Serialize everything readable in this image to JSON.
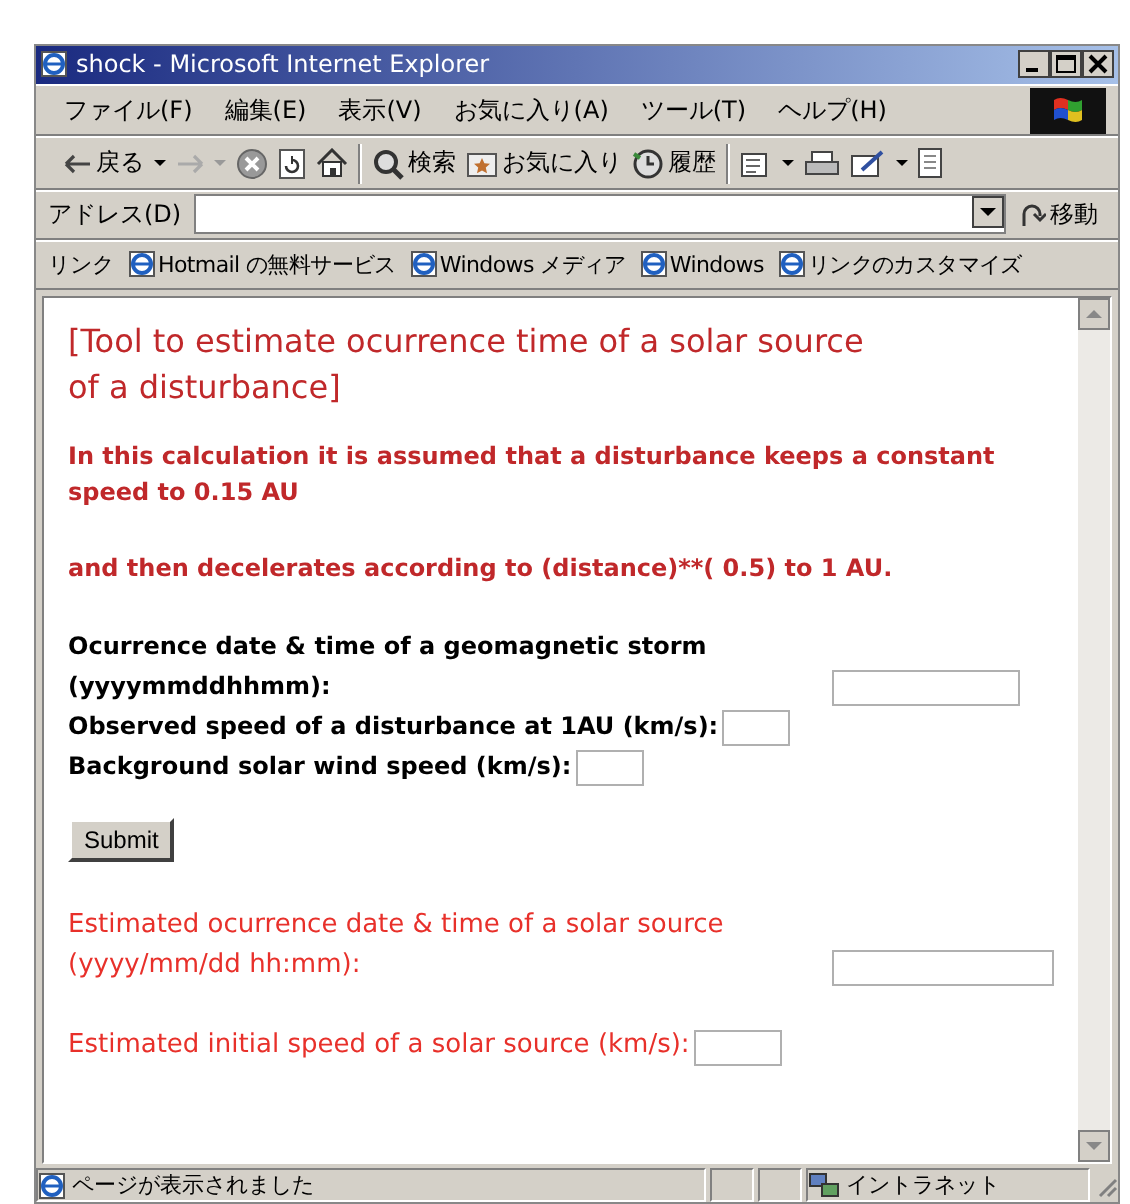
{
  "window": {
    "title": "shock - Microsoft Internet Explorer"
  },
  "menu": [
    "ファイル(F)",
    "編集(E)",
    "表示(V)",
    "お気に入り(A)",
    "ツール(T)",
    "ヘルプ(H)"
  ],
  "toolbar": {
    "buttons": [
      {
        "label": "戻る"
      },
      {
        "label": "検索"
      },
      {
        "label": "お気に入り"
      },
      {
        "label": "履歴"
      }
    ]
  },
  "address_bar": {
    "label": "アドレス(D)",
    "go": "移動"
  },
  "links_bar": {
    "label": "リンク",
    "items": [
      "Hotmail の無料サービス",
      "Windows メディア",
      "Windows",
      "リンクのカスタマイズ"
    ]
  },
  "page": {
    "heading": "[Tool to estimate ocurrence time of a solar source of a disturbance]",
    "notes": [
      "In this calculation it is assumed that a disturbance keeps a constant speed to 0.15 AU",
      "and then decelerates according to (distance)**( 0.5) to 1 AU."
    ],
    "inputs": [
      {
        "label": "Ocurrence date & time of a geomagnetic storm (yyyymmddhhmm):",
        "kind": "date"
      },
      {
        "label": "Observed speed of a disturbance at 1AU (km/s):",
        "kind": "speed"
      },
      {
        "label": "Background solar wind speed (km/s):",
        "kind": "speed"
      }
    ],
    "submit": "Submit",
    "outputs": [
      {
        "label": "Estimated ocurrence date & time of a solar source (yyyy/mm/dd hh:mm):",
        "kind": "date"
      },
      {
        "label": "Estimated initial speed of a solar source (km/s):",
        "kind": "speed"
      }
    ]
  },
  "status_bar": {
    "text": "ページが表示されました",
    "zone": "イントラネット"
  }
}
